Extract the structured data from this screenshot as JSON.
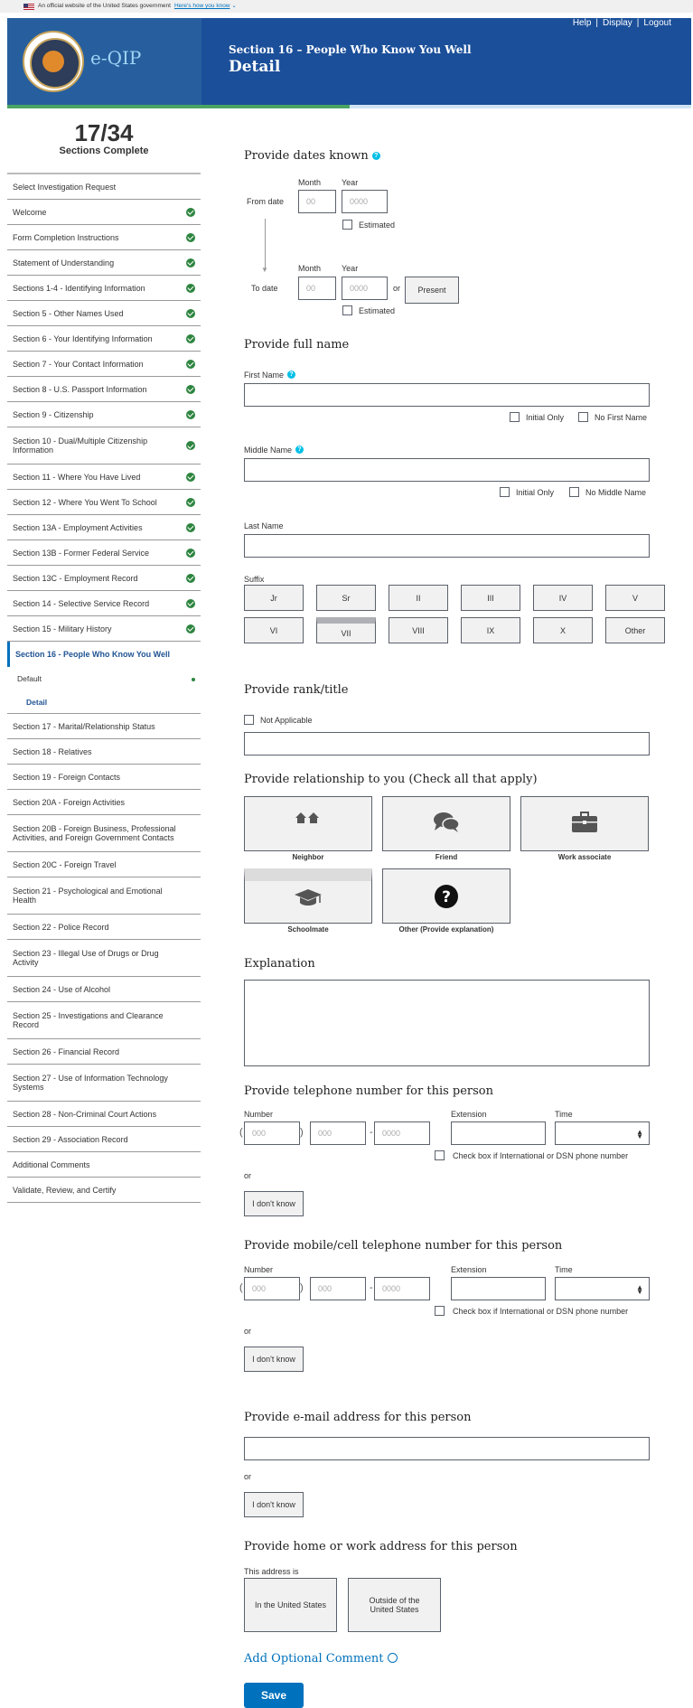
{
  "banner": {
    "text": "An official website of the United States government",
    "link": "Here's how you know"
  },
  "header": {
    "app_name": "e-QIP",
    "section_subtitle": "Section 16 – People Who Know You Well",
    "section_title": "Detail",
    "links": [
      "Help",
      "Display",
      "Logout"
    ],
    "progress_fraction": 0.5
  },
  "sidebar": {
    "counter": "17/34",
    "counter_label": "Sections Complete",
    "items": [
      {
        "label": "Select Investigation Request",
        "done": false,
        "lines": 1
      },
      {
        "label": "Welcome",
        "done": true,
        "lines": 1
      },
      {
        "label": "Form Completion Instructions",
        "done": true,
        "lines": 1
      },
      {
        "label": "Statement of Understanding",
        "done": true,
        "lines": 1
      },
      {
        "label": "Sections 1-4 - Identifying Information",
        "done": true,
        "lines": 1
      },
      {
        "label": "Section 5 - Other Names Used",
        "done": true,
        "lines": 1
      },
      {
        "label": "Section 6 - Your Identifying Information",
        "done": true,
        "lines": 1
      },
      {
        "label": "Section 7 - Your Contact Information",
        "done": true,
        "lines": 1
      },
      {
        "label": "Section 8 - U.S. Passport Information",
        "done": true,
        "lines": 1
      },
      {
        "label": "Section 9 - Citizenship",
        "done": true,
        "lines": 1
      },
      {
        "label": "Section 10 - Dual/Multiple Citizenship Information",
        "done": true,
        "lines": 2
      },
      {
        "label": "Section 11 - Where You Have Lived",
        "done": true,
        "lines": 1
      },
      {
        "label": "Section 12 - Where You Went To School",
        "done": true,
        "lines": 1
      },
      {
        "label": "Section 13A - Employment Activities",
        "done": true,
        "lines": 1
      },
      {
        "label": "Section 13B - Former Federal Service",
        "done": true,
        "lines": 1
      },
      {
        "label": "Section 13C - Employment Record",
        "done": true,
        "lines": 1
      },
      {
        "label": "Section 14 - Selective Service Record",
        "done": true,
        "lines": 1
      },
      {
        "label": "Section 15 - Military History",
        "done": true,
        "lines": 1
      }
    ],
    "current": {
      "label": "Section 16 - People Who Know You Well",
      "subs": [
        {
          "label": "Default",
          "done": true
        },
        {
          "label": "Detail",
          "active": true
        }
      ]
    },
    "items_after": [
      {
        "label": "Section 17 - Marital/Relationship Status",
        "lines": 1
      },
      {
        "label": "Section 18 - Relatives",
        "lines": 1
      },
      {
        "label": "Section 19 - Foreign Contacts",
        "lines": 1
      },
      {
        "label": "Section 20A - Foreign Activities",
        "lines": 1
      },
      {
        "label": "Section 20B - Foreign Business, Professional Activities, and Foreign Government Contacts",
        "lines": 2
      },
      {
        "label": "Section 20C - Foreign Travel",
        "lines": 1
      },
      {
        "label": "Section 21 - Psychological and Emotional Health",
        "lines": 2
      },
      {
        "label": "Section 22 - Police Record",
        "lines": 1
      },
      {
        "label": "Section 23 - Illegal Use of Drugs or Drug Activity",
        "lines": 2
      },
      {
        "label": "Section 24 - Use of Alcohol",
        "lines": 1
      },
      {
        "label": "Section 25 - Investigations and Clearance Record",
        "lines": 2
      },
      {
        "label": "Section 26 - Financial Record",
        "lines": 1
      },
      {
        "label": "Section 27 - Use of Information Technology Systems",
        "lines": 2
      },
      {
        "label": "Section 28 - Non-Criminal Court Actions",
        "lines": 1
      },
      {
        "label": "Section 29 - Association Record",
        "lines": 1
      },
      {
        "label": "Additional Comments",
        "lines": 1
      },
      {
        "label": "Validate, Review, and Certify",
        "lines": 1
      }
    ]
  },
  "dates": {
    "heading": "Provide dates known",
    "from_label": "From date",
    "to_label": "To date",
    "month_label": "Month",
    "year_label": "Year",
    "month_placeholder": "00",
    "year_placeholder": "0000",
    "estimated": "Estimated",
    "or": "or",
    "present": "Present"
  },
  "name": {
    "heading": "Provide full name",
    "first_label": "First Name",
    "middle_label": "Middle Name",
    "last_label": "Last Name",
    "initial_only": "Initial Only",
    "no_first": "No First Name",
    "no_middle": "No Middle Name",
    "suffix_label": "Suffix",
    "suffixes": [
      "Jr",
      "Sr",
      "II",
      "III",
      "IV",
      "V",
      "VI",
      "VII",
      "VIII",
      "IX",
      "X",
      "Other"
    ],
    "selected_suffix": "VII"
  },
  "rank": {
    "heading": "Provide rank/title",
    "not_applicable": "Not Applicable"
  },
  "relationship": {
    "heading": "Provide relationship to you (Check all that apply)",
    "options": [
      {
        "label": "Neighbor",
        "icon": "houses-icon"
      },
      {
        "label": "Friend",
        "icon": "chat-bubbles-icon"
      },
      {
        "label": "Work associate",
        "icon": "briefcase-icon"
      },
      {
        "label": "Schoolmate",
        "icon": "graduation-cap-icon",
        "selected": true
      },
      {
        "label": "Other (Provide explanation)",
        "icon": "question-circle-icon"
      }
    ]
  },
  "explanation": {
    "heading": "Explanation"
  },
  "phone": {
    "heading": "Provide telephone number for this person",
    "number_label": "Number",
    "extension_label": "Extension",
    "time_label": "Time",
    "area_placeholder": "000",
    "prefix_placeholder": "000",
    "line_placeholder": "0000",
    "intl_label": "Check box if International or DSN phone number",
    "or": "or",
    "dont_know": "I don't know"
  },
  "mobile": {
    "heading": "Provide mobile/cell telephone number for this person",
    "number_label": "Number",
    "extension_label": "Extension",
    "time_label": "Time",
    "area_placeholder": "000",
    "prefix_placeholder": "000",
    "line_placeholder": "0000",
    "intl_label": "Check box if International or DSN phone number",
    "or": "or",
    "dont_know": "I don't know"
  },
  "email": {
    "heading": "Provide e-mail address for this person",
    "or": "or",
    "dont_know": "I don't know"
  },
  "address": {
    "heading": "Provide home or work address for this person",
    "this_address_is": "This address is",
    "in_us": "In the United States",
    "outside_us": "Outside of the United States"
  },
  "footer": {
    "add_comment": "Add Optional Comment",
    "save": "Save"
  }
}
